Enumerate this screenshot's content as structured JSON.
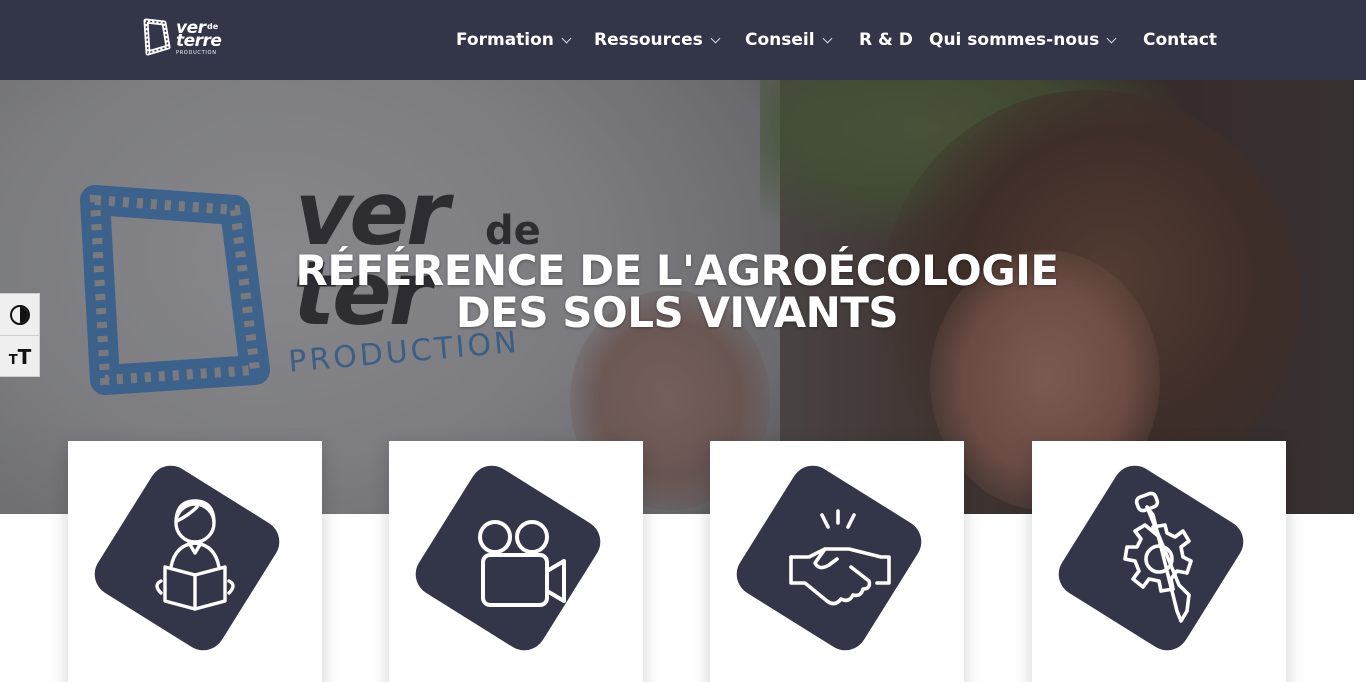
{
  "header": {
    "logo": {
      "line1": "ver",
      "line1_small": "de",
      "line2": "terre",
      "line3": "PRODUCTION"
    },
    "nav": [
      {
        "label": "Formation",
        "has_dropdown": true
      },
      {
        "label": "Ressources",
        "has_dropdown": true
      },
      {
        "label": "Conseil",
        "has_dropdown": true
      },
      {
        "label": "R & D",
        "has_dropdown": false
      },
      {
        "label": "Qui sommes-nous",
        "has_dropdown": true
      },
      {
        "label": "Contact",
        "has_dropdown": false
      }
    ]
  },
  "hero": {
    "title_line1": "RÉFÉRENCE DE L'AGROÉCOLOGIE",
    "title_line2": "DES SOLS VIVANTS",
    "shirt_print": {
      "ver": "ver",
      "de": "de",
      "terre": "ter",
      "production": "PRODUCTION"
    }
  },
  "accessibility": {
    "contrast_icon": "contrast-toggle-icon",
    "text_size_icon": "text-size-icon"
  },
  "cards": [
    {
      "icon": "person-reading-book-icon"
    },
    {
      "icon": "video-camera-icon"
    },
    {
      "icon": "handshake-icon"
    },
    {
      "icon": "gear-shovel-icon"
    }
  ],
  "colors": {
    "header_bg": "#333548",
    "icon_bg": "#333548",
    "text_light": "#ffffff"
  }
}
